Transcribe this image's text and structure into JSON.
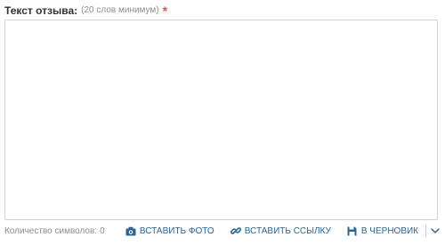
{
  "review": {
    "label": "Текст отзыва:",
    "hint": "(20 слов минимум)",
    "required_mark": "*",
    "text_value": ""
  },
  "footer": {
    "counter_label": "Количество символов:",
    "counter_value": "0",
    "actions": [
      {
        "label": "ВСТАВИТЬ ФОТО",
        "icon": "camera-icon"
      },
      {
        "label": "ВСТАВИТЬ ССЫЛКУ",
        "icon": "link-icon"
      },
      {
        "label": "В ЧЕРНОВИК",
        "icon": "save-icon"
      }
    ],
    "more_icon": "chevron-down-icon"
  },
  "colors": {
    "label_text": "#333333",
    "hint_text": "#8e8e8e",
    "required": "#d9534f",
    "action_text": "#2a6496",
    "border": "#d3d3d3"
  }
}
